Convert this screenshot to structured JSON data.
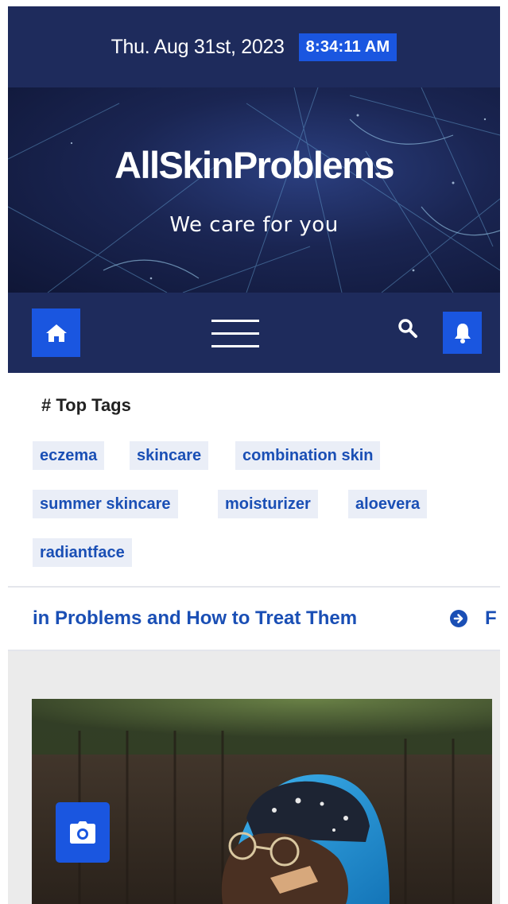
{
  "header": {
    "date": "Thu. Aug 31st, 2023",
    "time": "8:34:11 AM"
  },
  "site": {
    "title": "AllSkinProblems",
    "tagline": "We care for you"
  },
  "nav": {
    "home_icon": "home-icon",
    "menu_icon": "hamburger-menu-icon",
    "search_icon": "search-icon",
    "notification_icon": "bell-icon"
  },
  "tags": {
    "heading": "# Top Tags",
    "items": [
      "eczema",
      "skincare",
      "combination skin",
      "summer skincare",
      "moisturizer",
      "aloevera",
      "radiantface"
    ]
  },
  "ticker": {
    "current_text": "in Problems and How to Treat Them",
    "next_text": "F",
    "arrow_icon": "circle-arrow-right-icon"
  },
  "featured": {
    "camera_icon": "camera-icon"
  },
  "colors": {
    "navy": "#1e2b5c",
    "accent_blue": "#1a56e0",
    "tag_text": "#1a4fb5",
    "tag_bg": "#eaeef7"
  }
}
